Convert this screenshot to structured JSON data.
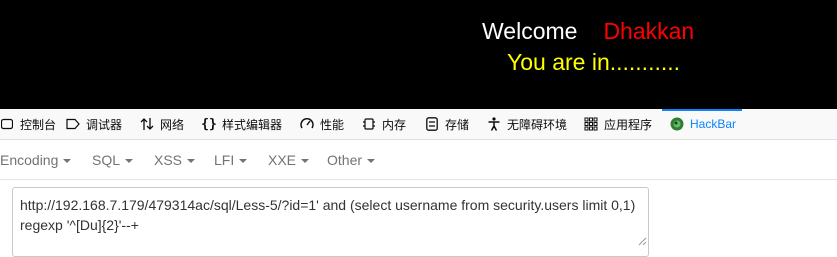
{
  "page": {
    "welcome_word": "Welcome",
    "welcome_name": "Dhakkan",
    "status_message": "You are in...........",
    "colors": {
      "background": "#000000",
      "welcome_word": "#ffffff",
      "welcome_name": "#ff0000",
      "status_message": "#ffff00"
    }
  },
  "devtools": {
    "tabs": [
      {
        "label": "控制台",
        "icon": "console-icon"
      },
      {
        "label": "调试器",
        "icon": "debugger-icon"
      },
      {
        "label": "网络",
        "icon": "network-icon"
      },
      {
        "label": "样式编辑器",
        "icon": "style-editor-icon"
      },
      {
        "label": "性能",
        "icon": "performance-icon"
      },
      {
        "label": "内存",
        "icon": "memory-icon"
      },
      {
        "label": "存储",
        "icon": "storage-icon"
      },
      {
        "label": "无障碍环境",
        "icon": "accessibility-icon"
      },
      {
        "label": "应用程序",
        "icon": "application-icon"
      },
      {
        "label": "HackBar",
        "icon": "hackbar-icon",
        "active": true
      }
    ],
    "accent_color": "#0a84ff"
  },
  "hackbar": {
    "menu": [
      {
        "label": "Encoding"
      },
      {
        "label": "SQL"
      },
      {
        "label": "XSS"
      },
      {
        "label": "LFI"
      },
      {
        "label": "XXE"
      },
      {
        "label": "Other"
      }
    ],
    "url_value": "http://192.168.7.179/479314ac/sql/Less-5/?id=1' and (select username from security.users limit 0,1) regexp '^[Du]{2}'--+"
  }
}
